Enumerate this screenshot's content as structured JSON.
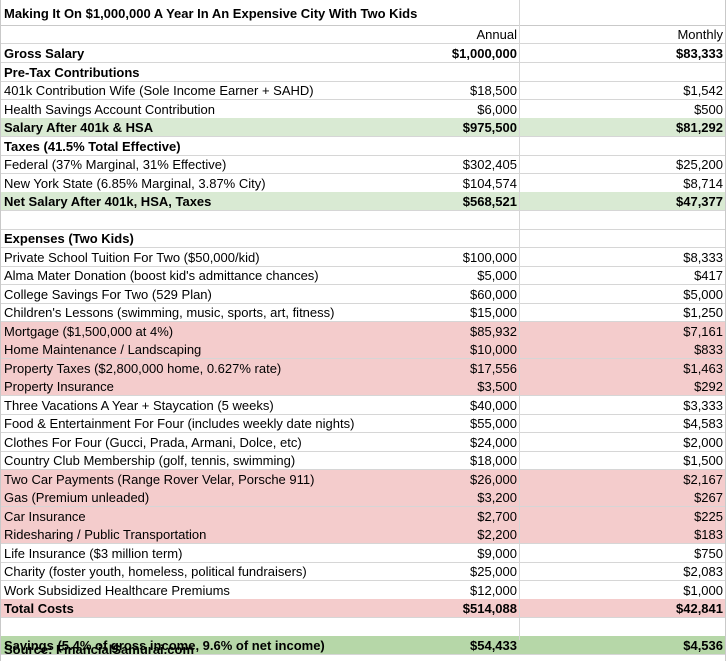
{
  "title": "Making It On $1,000,000 A Year In An Expensive City With Two Kids",
  "headers": {
    "annual": "Annual",
    "monthly": "Monthly"
  },
  "rows": [
    {
      "label": "Gross Salary",
      "annual": "$1,000,000",
      "monthly": "$83,333",
      "style": "bold"
    },
    {
      "label": "Pre-Tax Contributions",
      "annual": "",
      "monthly": "",
      "style": "bold"
    },
    {
      "label": "401k Contribution Wife (Sole Income Earner + SAHD)",
      "annual": "$18,500",
      "monthly": "$1,542",
      "style": ""
    },
    {
      "label": "Health Savings Account Contribution",
      "annual": "$6,000",
      "monthly": "$500",
      "style": ""
    },
    {
      "label": "Salary After 401k & HSA",
      "annual": "$975,500",
      "monthly": "$81,292",
      "style": "bold green"
    },
    {
      "label": "Taxes (41.5% Total Effective)",
      "annual": "",
      "monthly": "",
      "style": "bold"
    },
    {
      "label": "Federal (37% Marginal, 31% Effective)",
      "annual": "$302,405",
      "monthly": "$25,200",
      "style": ""
    },
    {
      "label": "New York State (6.85% Marginal, 3.87% City)",
      "annual": "$104,574",
      "monthly": "$8,714",
      "style": ""
    },
    {
      "label": "Net Salary After 401k, HSA, Taxes",
      "annual": "$568,521",
      "monthly": "$47,377",
      "style": "bold green"
    },
    {
      "label": "",
      "annual": "",
      "monthly": "",
      "style": ""
    },
    {
      "label": "Expenses (Two Kids)",
      "annual": "",
      "monthly": "",
      "style": "bold"
    },
    {
      "label": "Private School Tuition For Two ($50,000/kid)",
      "annual": "$100,000",
      "monthly": "$8,333",
      "style": ""
    },
    {
      "label": "Alma Mater Donation (boost kid's admittance chances)",
      "annual": "$5,000",
      "monthly": "$417",
      "style": ""
    },
    {
      "label": "College Savings For Two (529 Plan)",
      "annual": "$60,000",
      "monthly": "$5,000",
      "style": ""
    },
    {
      "label": "Children's Lessons (swimming, music, sports, art, fitness)",
      "annual": "$15,000",
      "monthly": "$1,250",
      "style": ""
    },
    {
      "label": "Mortgage ($1,500,000 at 4%)",
      "annual": "$85,932",
      "monthly": "$7,161",
      "style": "red"
    },
    {
      "label": "Home Maintenance / Landscaping",
      "annual": "$10,000",
      "monthly": "$833",
      "style": "red"
    },
    {
      "label": "Property Taxes ($2,800,000 home, 0.627% rate)",
      "annual": "$17,556",
      "monthly": "$1,463",
      "style": "red"
    },
    {
      "label": "Property Insurance",
      "annual": "$3,500",
      "monthly": "$292",
      "style": "red"
    },
    {
      "label": "Three Vacations A Year + Staycation (5 weeks)",
      "annual": "$40,000",
      "monthly": "$3,333",
      "style": ""
    },
    {
      "label": "Food & Entertainment For Four (includes weekly date nights)",
      "annual": "$55,000",
      "monthly": "$4,583",
      "style": ""
    },
    {
      "label": "Clothes For Four (Gucci, Prada, Armani, Dolce, etc)",
      "annual": "$24,000",
      "monthly": "$2,000",
      "style": ""
    },
    {
      "label": "Country Club Membership (golf, tennis, swimming)",
      "annual": "$18,000",
      "monthly": "$1,500",
      "style": ""
    },
    {
      "label": "Two Car Payments (Range Rover Velar, Porsche 911)",
      "annual": "$26,000",
      "monthly": "$2,167",
      "style": "red"
    },
    {
      "label": "Gas (Premium unleaded)",
      "annual": "$3,200",
      "monthly": "$267",
      "style": "red"
    },
    {
      "label": "Car Insurance",
      "annual": "$2,700",
      "monthly": "$225",
      "style": "red"
    },
    {
      "label": "Ridesharing / Public Transportation",
      "annual": "$2,200",
      "monthly": "$183",
      "style": "red"
    },
    {
      "label": "Life Insurance ($3 million term)",
      "annual": "$9,000",
      "monthly": "$750",
      "style": ""
    },
    {
      "label": "Charity (foster youth, homeless, political fundraisers)",
      "annual": "$25,000",
      "monthly": "$2,083",
      "style": ""
    },
    {
      "label": "Work Subsidized Healthcare Premiums",
      "annual": "$12,000",
      "monthly": "$1,000",
      "style": ""
    },
    {
      "label": "Total Costs",
      "annual": "$514,088",
      "monthly": "$42,841",
      "style": "bold red"
    },
    {
      "label": "",
      "annual": "",
      "monthly": "",
      "style": ""
    },
    {
      "label": "Savings (5.4% of gross income, 9.6% of net income)",
      "annual": "$54,433",
      "monthly": "$4,536",
      "style": "bold green-strong"
    }
  ],
  "source": "Source: FinancialSamurai.com"
}
